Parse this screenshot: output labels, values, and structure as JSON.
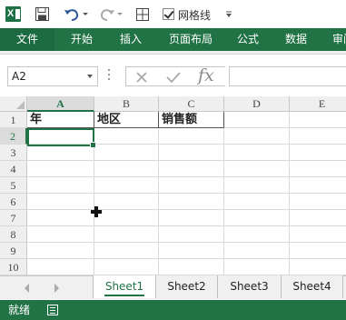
{
  "qat": {
    "gridlines_label": "网格线",
    "gridlines_checked": true
  },
  "ribbon": {
    "tabs": [
      "文件",
      "开始",
      "插入",
      "页面布局",
      "公式",
      "数据",
      "审阅"
    ]
  },
  "formula_bar": {
    "name_box": "A2",
    "fx_label": "fx",
    "content": ""
  },
  "grid": {
    "columns": [
      "A",
      "B",
      "C",
      "D",
      "E"
    ],
    "active_column": "A",
    "rows": [
      "1",
      "2",
      "3",
      "4",
      "5",
      "6",
      "7",
      "8",
      "9",
      "10"
    ],
    "active_row": "2",
    "cells": {
      "A1": "年",
      "B1": "地区",
      "C1": "销售额"
    }
  },
  "sheet_tabs": [
    "Sheet1",
    "Sheet2",
    "Sheet3",
    "Sheet4"
  ],
  "active_sheet": "Sheet1",
  "status": {
    "ready": "就绪"
  },
  "colors": {
    "accent": "#217346",
    "ribbon": "#217346",
    "status_bar": "#217346"
  }
}
